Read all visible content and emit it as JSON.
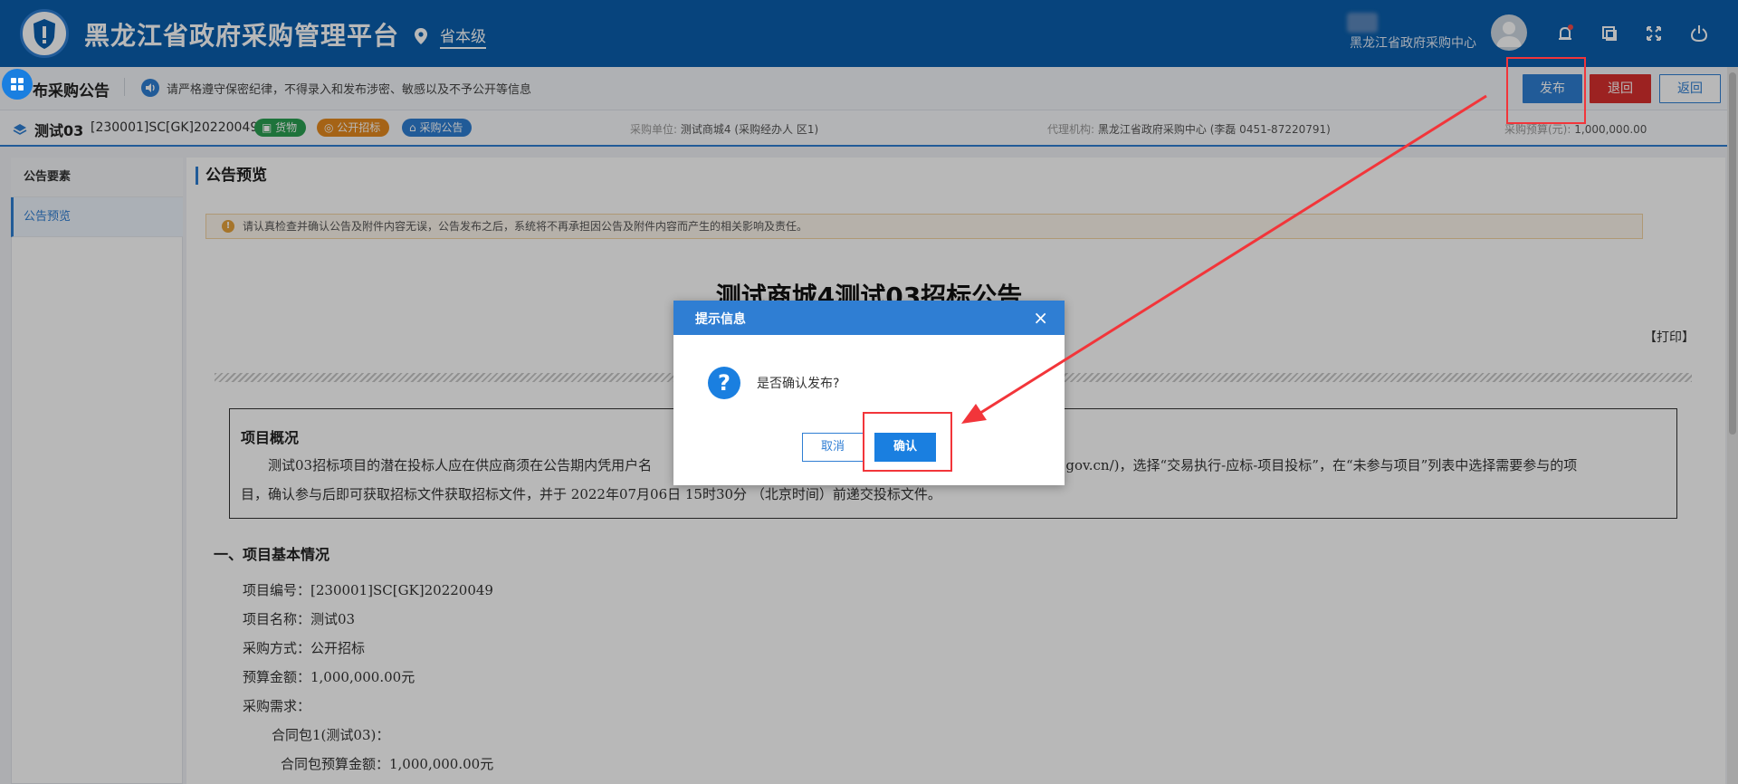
{
  "header": {
    "app_title": "黑龙江省政府采购管理平台",
    "region": "省本级",
    "org_name": "黑龙江省政府采购中心",
    "icons": [
      "location-icon",
      "bell-icon",
      "switch-window-icon",
      "fullscreen-icon",
      "power-icon"
    ]
  },
  "subbar": {
    "page_heading": "布采购公告",
    "notice": "请严格遵守保密纪律，不得录入和发布涉密、敏感以及不予公开等信息",
    "publish_label": "发布",
    "back_label": "退回",
    "return_label": "返回"
  },
  "project": {
    "name": "测试03",
    "code": "[230001]SC[GK]20220049",
    "tags": [
      "货物",
      "公开招标",
      "采购公告"
    ],
    "purchaser_label": "采购单位:",
    "purchaser": "测试商城4 (采购经办人 区1)",
    "agency_label": "代理机构:",
    "agency": "黑龙江省政府采购中心 (李磊 0451-87220791)",
    "budget_label": "采购预算(元):",
    "budget": "1,000,000.00"
  },
  "nav": {
    "items": [
      "公告要素",
      "公告预览"
    ]
  },
  "preview": {
    "section_title": "公告预览",
    "warning": "请认真检查并确认公告及附件内容无误，公告发布之后，系统将不再承担因公告及附件内容而产生的相关影响及责任。",
    "doc_title": "测试商城4测试03招标公告",
    "print_label": "【打印】",
    "overview_title": "项目概况",
    "overview_line1_a": "测试03招标项目的潜在投标人应在供应商须在公告期内凭用户名",
    "overview_line1_b": "j.gov.cn/)，选择“交易执行-应标-项目投标”，在“未参与项目”列表中选择需要参与的项",
    "overview_line2": "目，确认参与后即可获取招标文件获取招标文件，并于 2022年07月06日 15时30分 （北京时间）前递交投标文件。",
    "section1": "一、项目基本情况",
    "rows": [
      "项目编号：[230001]SC[GK]20220049",
      "项目名称：测试03",
      "采购方式：公开招标",
      "预算金额：1,000,000.00元",
      "采购需求："
    ],
    "package": "合同包1(测试03)：",
    "package_budget": "合同包预算金额：1,000,000.00元"
  },
  "dialog": {
    "title": "提示信息",
    "close": "×",
    "icon": "question-icon",
    "message": "是否确认发布?",
    "cancel_label": "取消",
    "confirm_label": "确认"
  },
  "annotation": {
    "color": "#f2353a"
  },
  "colors": {
    "header_bg": "#0a5fad",
    "accent": "#2f7ed3",
    "danger": "#d9302f"
  }
}
